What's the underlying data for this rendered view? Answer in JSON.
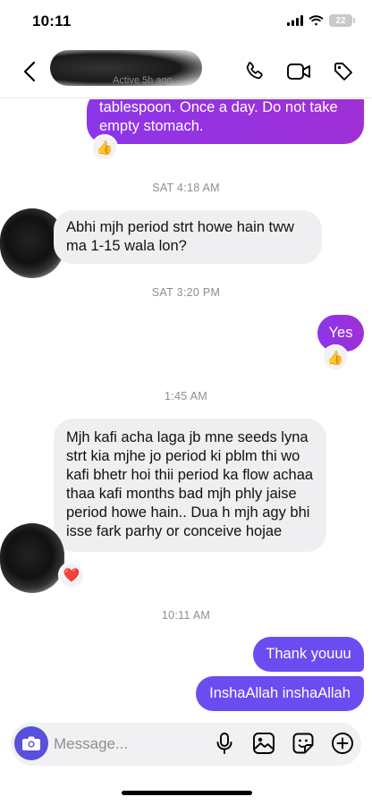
{
  "status_bar": {
    "time": "10:11",
    "battery": "22"
  },
  "header": {
    "contact_subtitle": "Active 5h ago"
  },
  "composer": {
    "placeholder": "Message..."
  },
  "messages": [
    {
      "text": "tablespoon. Once a day. Do not take empty stomach.",
      "reaction": "👍"
    },
    {
      "timestamp": "SAT 4:18 AM"
    },
    {
      "text": "Abhi mjh period strt howe hain tww ma 1-15 wala lon?"
    },
    {
      "timestamp": "SAT 3:20 PM"
    },
    {
      "text": "Yes",
      "reaction": "👍"
    },
    {
      "timestamp": "1:45 AM"
    },
    {
      "text": "Mjh kafi acha laga jb mne seeds lyna strt kia mjhe jo period ki pblm thi wo kafi bhetr hoi thii period ka flow achaa thaa kafi months bad mjh phly jaise period howe hain.. Dua h mjh agy bhi isse fark parhy or conceive hojae",
      "reaction": "❤️"
    },
    {
      "timestamp": "10:11 AM"
    },
    {
      "text": "Thank youuu"
    },
    {
      "text": "InshaAllah inshaAllah"
    }
  ],
  "colors": {
    "outgoing_top": "#8c35ea",
    "outgoing_bottom": "#6b4cf0",
    "incoming": "#efeff1",
    "camera": "#5851db"
  }
}
